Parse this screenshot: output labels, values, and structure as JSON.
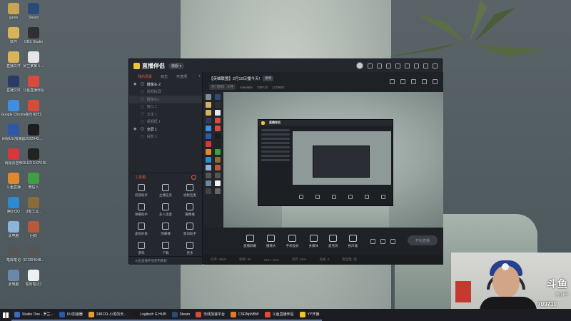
{
  "desktop": {
    "icons": [
      {
        "label": "game",
        "color": "#c9a453"
      },
      {
        "label": "Steam",
        "color": "#2a4a78"
      },
      {
        "label": "软件",
        "color": "#d9b35a"
      },
      {
        "label": "OBS Studio",
        "color": "#303030"
      },
      {
        "label": "直播文件",
        "color": "#d9b35a"
      },
      {
        "label": "罗兰某某 1 ...",
        "color": "#e6e6e6"
      },
      {
        "label": "直播文件",
        "color": "#2a3c66"
      },
      {
        "label": "斗鱼直播伴侣",
        "color": "#d74a3c"
      },
      {
        "label": "Google Chrome",
        "color": "#3f8fe0"
      },
      {
        "label": "金币花样2",
        "color": "#d74a3c"
      },
      {
        "label": "网易UU加速器",
        "color": "#2b58a8"
      },
      {
        "label": "2022042...",
        "color": "#1d1d1d"
      },
      {
        "label": "网易云音乐",
        "color": "#d8363a"
      },
      {
        "label": "VOLED EXPERI...",
        "color": "#222"
      },
      {
        "label": "斗鱼直播",
        "color": "#e2882c"
      },
      {
        "label": "微信人",
        "color": "#3ea040"
      },
      {
        "label": "腾讯QQ",
        "color": "#2a8ad2"
      },
      {
        "label": "U盘工具...",
        "color": "#8a6c3a"
      },
      {
        "label": "此电脑",
        "color": "#8ab4d8"
      },
      {
        "label": "回收",
        "color": "#b85a3a"
      },
      {
        "label": "笔库笔记",
        "color": "#555"
      },
      {
        "label": "321264548...",
        "color": "#555"
      },
      {
        "label": "此电脑",
        "color": "#6a88aa"
      },
      {
        "label": "笔库笔记1",
        "color": "#f0f0f0"
      }
    ]
  },
  "app": {
    "title": "直播伴侣",
    "version": "旗舰 ▾",
    "left_tabs": [
      "我的场景",
      "双击",
      "可选项"
    ],
    "scenes": [
      {
        "label": "摄像头 2",
        "visible": true,
        "active": true,
        "highlight": false
      },
      {
        "label": "视频投屏",
        "visible": false,
        "active": false,
        "highlight": false
      },
      {
        "label": "摄像头1",
        "visible": false,
        "active": false,
        "highlight": true
      },
      {
        "label": "窗口 1",
        "visible": false,
        "active": false,
        "highlight": false
      },
      {
        "label": "文本 1",
        "visible": false,
        "active": false,
        "highlight": false
      },
      {
        "label": "视频框 1",
        "visible": false,
        "active": false,
        "highlight": false
      },
      {
        "label": "全屏 1",
        "visible": true,
        "active": true,
        "highlight": false
      },
      {
        "label": "投影 1",
        "visible": false,
        "active": false,
        "highlight": false
      }
    ],
    "tools_title": "工具箱",
    "tools": [
      "房管助手",
      "主播任务",
      "视频连麦",
      "弹幕助手",
      "多人连麦",
      "摄像播",
      "虚拟形象",
      "弹幕播",
      "歌词助手",
      "游戏",
      "下载",
      "更多"
    ],
    "footer_text": "斗鱼直播伴侣使用教程",
    "stream_title": "【英雄联盟】2月10日播今天!",
    "stream_title_btn": "修改",
    "stream_tags": [
      "热门游戏 · 大神",
      "miaolabs",
      "709710",
      "1278687"
    ],
    "controls": [
      {
        "label": "直播屏幕",
        "icon": "screen-icon"
      },
      {
        "label": "摄像头",
        "icon": "camera-icon"
      },
      {
        "label": "手机投屏",
        "icon": "phone-icon"
      },
      {
        "label": "多媒体",
        "icon": "media-icon"
      },
      {
        "label": "麦克风",
        "icon": "mic-icon"
      },
      {
        "label": "扬声器",
        "icon": "speaker-icon"
      }
    ],
    "start_live_label": "开始直播",
    "status": [
      "码率: 0kb/s",
      "帧率: 60",
      "CPU: 12%",
      "内存: 56%",
      "丢帧: 0",
      "稳定性: 高"
    ]
  },
  "nested_window": {
    "title": "直播伴侣"
  },
  "webcam": {
    "logo_text": "斗鱼",
    "room_label": "房间号",
    "room_id": "709710"
  },
  "taskbar": {
    "items": [
      {
        "label": "Studio One - 罗兰...",
        "color": "#3b6ac8"
      },
      {
        "label": "UU加速器",
        "color": "#2b58a8"
      },
      {
        "label": "248131-小爱的天...",
        "color": "#e3a02a"
      },
      {
        "label": "Logitech G HUB",
        "color": "#1a1a1a"
      },
      {
        "label": "Steam",
        "color": "#2a4a78"
      },
      {
        "label": "无线加速平台",
        "color": "#d74a3c"
      },
      {
        "label": "CSRNpNBW",
        "color": "#e07a2a"
      },
      {
        "label": "斗鱼直播伴侣",
        "color": "#e44a3a"
      },
      {
        "label": "YY开播",
        "color": "#f2c52a"
      }
    ]
  }
}
